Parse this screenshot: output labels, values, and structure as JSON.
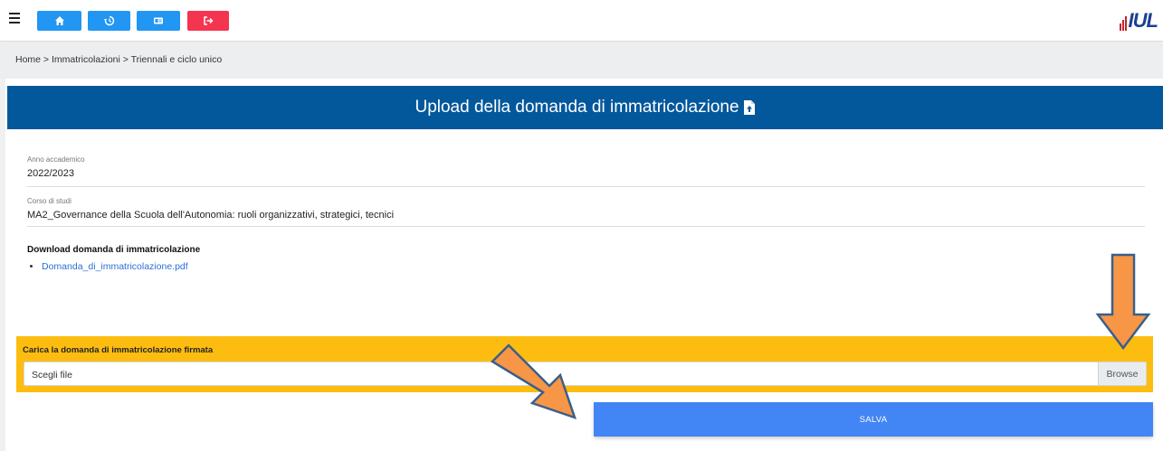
{
  "topbar": {
    "menu_icon": "hamburger-icon",
    "buttons": [
      {
        "icon": "home-icon",
        "color": "#2196f3"
      },
      {
        "icon": "history-icon",
        "color": "#2196f3"
      },
      {
        "icon": "id-card-icon",
        "color": "#2196f3"
      },
      {
        "icon": "logout-icon",
        "color": "#f5344f"
      }
    ],
    "logo_text": "IUL"
  },
  "breadcrumb": "Home > Immatricolazioni > Triennali e ciclo unico",
  "header": {
    "title": "Upload della domanda di immatricolazione",
    "icon": "file-upload-icon",
    "color": "#03589c"
  },
  "fields": {
    "anno_label": "Anno accademico",
    "anno_value": "2022/2023",
    "corso_label": "Corso di studi",
    "corso_value": "MA2_Governance della Scuola dell'Autonomia: ruoli organizzativi, strategici, tecnici"
  },
  "download": {
    "title": "Download domanda di immatricolazione",
    "file_link": "Domanda_di_immatricolazione.pdf"
  },
  "upload": {
    "label": "Carica la domanda di immatricolazione firmata",
    "placeholder": "Scegli file",
    "browse_label": "Browse",
    "color": "#fdbd10"
  },
  "save_label": "SALVA",
  "annotation_color": "#f79646"
}
